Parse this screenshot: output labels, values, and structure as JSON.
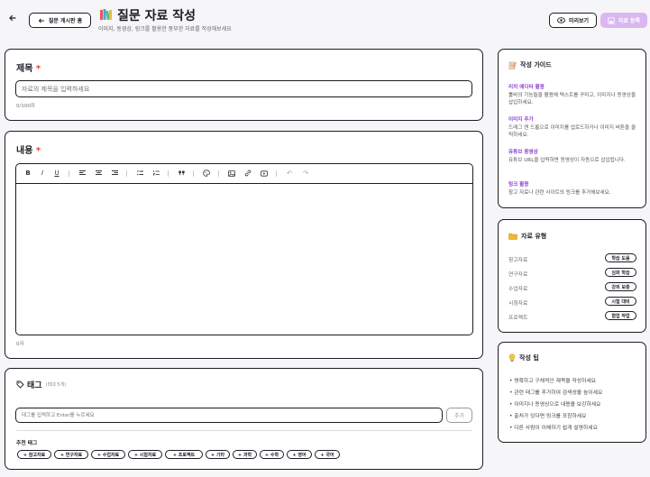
{
  "header": {
    "back_label": "질문 게시판 홈",
    "title": "질문 자료 작성",
    "subtitle": "이미지, 동영상, 링크를 활용한 풍부한 자료를 작성해보세요",
    "preview_label": "미리보기",
    "submit_label": "자료 등록"
  },
  "title_section": {
    "label": "제목",
    "required_mark": "*",
    "placeholder": "자료의 제목을 입력하세요",
    "counter": "0/100자"
  },
  "content_section": {
    "label": "내용",
    "required_mark": "*",
    "toolbar": {
      "bold": "B",
      "italic": "I",
      "underline": "U",
      "undo": "↶",
      "redo": "↷"
    },
    "counter": "0자"
  },
  "tags_section": {
    "label": "태그",
    "hint": "(최대 5개)",
    "placeholder": "태그를 입력하고 Enter를 누르세요",
    "add_label": "추가",
    "recommended_label": "추천 태그",
    "recommended": [
      "+ 참고자료",
      "+ 연구자료",
      "+ 수업자료",
      "+ 시험자료",
      "+ 프로젝트",
      "+ 기타",
      "+ 과학",
      "+ 수학",
      "+ 영어",
      "+ 국어"
    ]
  },
  "guide": {
    "title": "작성 가이드",
    "items": [
      {
        "heading": "리치 에디터 활용",
        "body": "툴바의 기능들을 활용해 텍스트를 꾸미고, 이미지나 동영상을 삽입하세요."
      },
      {
        "heading": "이미지 추가",
        "body": "드래그 앤 드롭으로 이미지를 업로드하거나 이미지 버튼을 클릭하세요."
      },
      {
        "heading": "유튜브 동영상",
        "body": "유튜브 URL을 입력하면 동영상이 자동으로 삽입됩니다."
      },
      {
        "heading": "링크 활용",
        "body": "참고 자료나 관련 사이트의 링크를 추가해보세요."
      }
    ]
  },
  "types": {
    "title": "자료 유형",
    "items": [
      {
        "label": "참고자료",
        "badge": "학습 도움"
      },
      {
        "label": "연구자료",
        "badge": "심화 학습"
      },
      {
        "label": "수업자료",
        "badge": "강의 보충"
      },
      {
        "label": "시험자료",
        "badge": "시험 대비"
      },
      {
        "label": "프로젝트",
        "badge": "협업 작업"
      }
    ]
  },
  "tips": {
    "title": "작성 팁",
    "items": [
      "• 명확하고 구체적인 제목을 작성하세요",
      "• 관련 태그를 추가하여 검색성을 높이세요",
      "• 이미지나 동영상으로 내용을 보강하세요",
      "• 출처가 있다면 링크를 포함하세요",
      "• 다른 사람이 이해하기 쉽게 설명하세요"
    ]
  },
  "colors": {
    "accent": "#8b3fd0",
    "submit_bg": "#d9b8f2",
    "required": "#e0443e",
    "border": "#1c1c24"
  }
}
